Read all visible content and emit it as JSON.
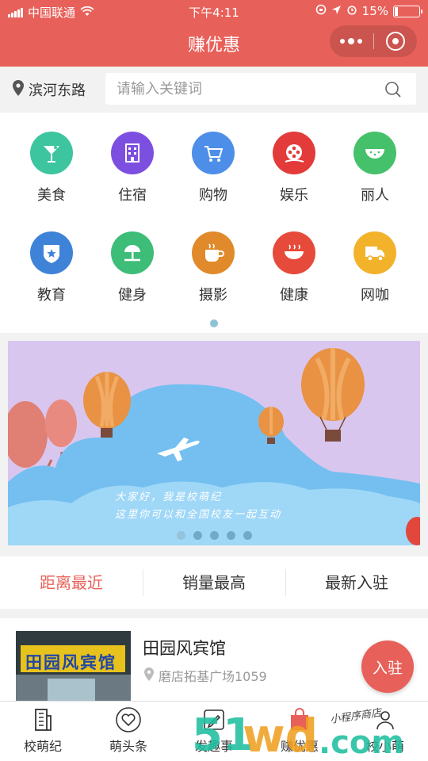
{
  "status_bar": {
    "carrier": "中国联通",
    "time": "下午4:11",
    "battery": "15%",
    "battery_level": 0.15
  },
  "title_bar": {
    "title": "赚优惠"
  },
  "search": {
    "location": "滨河东路",
    "placeholder": "请输入关键词"
  },
  "categories": [
    {
      "label": "美食",
      "icon": "cocktail-icon",
      "color": "#3cc59f"
    },
    {
      "label": "住宿",
      "icon": "building-icon",
      "color": "#7d4fe0"
    },
    {
      "label": "购物",
      "icon": "cart-icon",
      "color": "#4d8ee8"
    },
    {
      "label": "娱乐",
      "icon": "film-reel-icon",
      "color": "#e33a3a"
    },
    {
      "label": "丽人",
      "icon": "watermelon-icon",
      "color": "#46c16b"
    },
    {
      "label": "教育",
      "icon": "badge-star-icon",
      "color": "#3e83d8"
    },
    {
      "label": "健身",
      "icon": "tree-icon",
      "color": "#3dbd78"
    },
    {
      "label": "摄影",
      "icon": "cup-icon",
      "color": "#e08a2c"
    },
    {
      "label": "健康",
      "icon": "bowl-icon",
      "color": "#e64a3a"
    },
    {
      "label": "网咖",
      "icon": "truck-icon",
      "color": "#f2b22a"
    }
  ],
  "banner": {
    "line1": "大家好，我是校萌纪",
    "line2": "这里你可以和全国校友一起互动",
    "slide_count": 5,
    "active_slide": 0
  },
  "sort_tabs": [
    {
      "label": "距离最近",
      "active": true
    },
    {
      "label": "销量最高",
      "active": false
    },
    {
      "label": "最新入驻",
      "active": false
    }
  ],
  "shop": {
    "name": "田园风宾馆",
    "address": "磨店拓基广场1059",
    "sign_text": "田园风宾馆"
  },
  "fab": {
    "label": "入驻"
  },
  "bottom_nav": [
    {
      "label": "校萌纪",
      "icon": "building-outline-icon"
    },
    {
      "label": "萌头条",
      "icon": "heart-outline-icon"
    },
    {
      "label": "发趣事",
      "icon": "pen-icon"
    },
    {
      "label": "赚优惠",
      "icon": "bag-icon"
    },
    {
      "label": "校小萌",
      "icon": "person-icon"
    }
  ],
  "watermark": {
    "logo": "51wd.com",
    "script": "小程序商店"
  }
}
